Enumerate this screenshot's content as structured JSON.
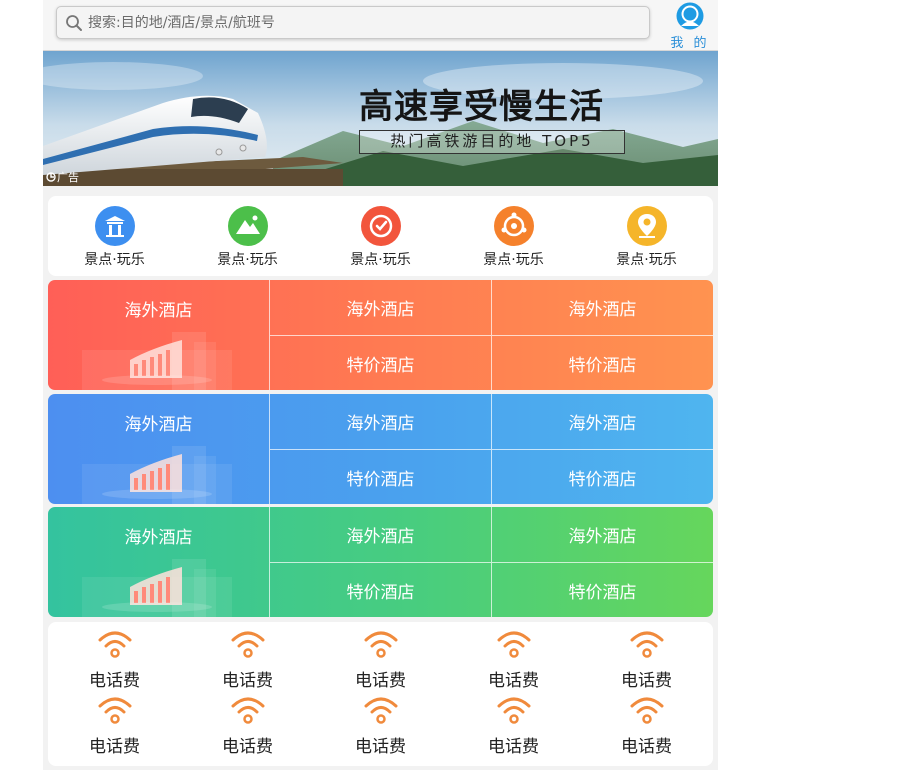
{
  "header": {
    "search_placeholder": "搜索:目的地/酒店/景点/航班号",
    "me_label": "我 的"
  },
  "banner": {
    "headline": "高速享受慢生活",
    "subline": "热门高铁游目的地 TOP5",
    "ad_label": "广告"
  },
  "categories": [
    {
      "label": "景点·玩乐",
      "icon": "temple-icon",
      "color": "#3d8ff0"
    },
    {
      "label": "景点·玩乐",
      "icon": "mountain-icon",
      "color": "#4cbf4a"
    },
    {
      "label": "景点·玩乐",
      "icon": "badge-icon",
      "color": "#f2553c"
    },
    {
      "label": "景点·玩乐",
      "icon": "star-ring-icon",
      "color": "#f5812c"
    },
    {
      "label": "景点·玩乐",
      "icon": "location-pin-icon",
      "color": "#f5b52a"
    }
  ],
  "hotel_grids": [
    {
      "main": "海外酒店",
      "cells": [
        "海外酒店",
        "海外酒店",
        "特价酒店",
        "特价酒店"
      ]
    },
    {
      "main": "海外酒店",
      "cells": [
        "海外酒店",
        "海外酒店",
        "特价酒店",
        "特价酒店"
      ]
    },
    {
      "main": "海外酒店",
      "cells": [
        "海外酒店",
        "海外酒店",
        "特价酒店",
        "特价酒店"
      ]
    }
  ],
  "services": [
    {
      "label": "电话费",
      "icon": "wifi-icon"
    },
    {
      "label": "电话费",
      "icon": "wifi-icon"
    },
    {
      "label": "电话费",
      "icon": "wifi-icon"
    },
    {
      "label": "电话费",
      "icon": "wifi-icon"
    },
    {
      "label": "电话费",
      "icon": "wifi-icon"
    },
    {
      "label": "电话费",
      "icon": "wifi-icon"
    },
    {
      "label": "电话费",
      "icon": "wifi-icon"
    },
    {
      "label": "电话费",
      "icon": "wifi-icon"
    },
    {
      "label": "电话费",
      "icon": "wifi-icon"
    },
    {
      "label": "电话费",
      "icon": "wifi-icon"
    }
  ],
  "colors": {
    "accent_blue": "#2a8fd8",
    "service_icon": "#f08a3c"
  }
}
